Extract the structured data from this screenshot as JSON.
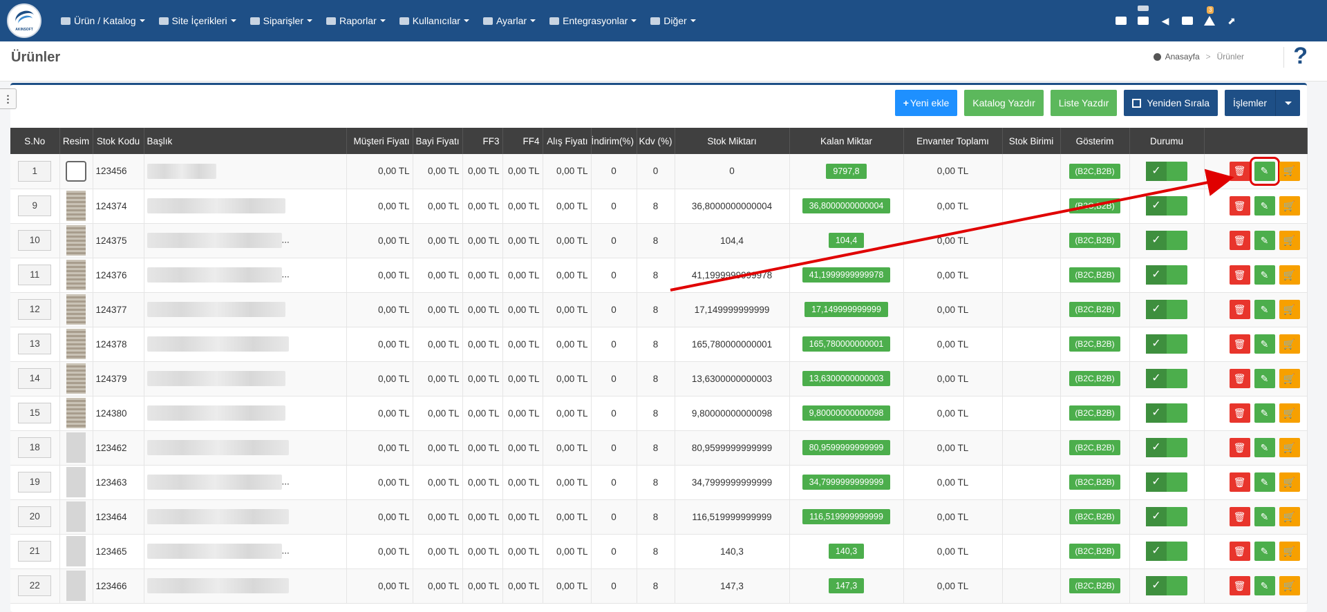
{
  "topbar": {
    "logo_text": "AKINSOFT",
    "nav": [
      {
        "label": "Ürün / Katalog",
        "icon": "boxes-icon"
      },
      {
        "label": "Site İçerikleri",
        "icon": "pages-icon"
      },
      {
        "label": "Siparişler",
        "icon": "truck-icon"
      },
      {
        "label": "Raporlar",
        "icon": "report-icon"
      },
      {
        "label": "Kullanıcılar",
        "icon": "users-icon"
      },
      {
        "label": "Ayarlar",
        "icon": "gears-icon"
      },
      {
        "label": "Entegrasyonlar",
        "icon": "sitemap-icon"
      },
      {
        "label": "Diğer",
        "icon": "copy-icon"
      }
    ],
    "notification_count": "3"
  },
  "header": {
    "title": "Ürünler",
    "breadcrumb_home": "Anasayfa",
    "breadcrumb_sep": ">",
    "breadcrumb_current": "Ürünler",
    "help": "?"
  },
  "toolbar": {
    "new_label": "Yeni ekle",
    "catalog_print": "Katalog Yazdır",
    "list_print": "Liste Yazdır",
    "reorder": "Yeniden Sırala",
    "actions": "İşlemler"
  },
  "table": {
    "headers": [
      "S.No",
      "Resim",
      "Stok Kodu",
      "Başlık",
      "Müşteri Fiyatı",
      "Bayi Fiyatı",
      "FF3",
      "FF4",
      "Alış Fiyatı",
      "İndirim(%)",
      "Kdv (%)",
      "Stok Miktarı",
      "Kalan Miktar",
      "Envanter Toplamı",
      "Stok Birimi",
      "Gösterim",
      "Durumu",
      ""
    ],
    "rows": [
      {
        "sno": "1",
        "img": "camera",
        "code": "123456",
        "title_w": 100,
        "more": "",
        "musteri": "0,00 TL",
        "bayi": "0,00 TL",
        "ff3": "0,00 TL",
        "ff4": "0,00 TL",
        "alis": "0,00 TL",
        "indirim": "0",
        "kdv": "0",
        "stok": "0",
        "kalan": "9797,8",
        "envanter": "0,00 TL",
        "gosterim": "(B2C,B2B)"
      },
      {
        "sno": "9",
        "img": "paper",
        "code": "124374",
        "title_w": 200,
        "more": "",
        "musteri": "0,00 TL",
        "bayi": "0,00 TL",
        "ff3": "0,00 TL",
        "ff4": "0,00 TL",
        "alis": "0,00 TL",
        "indirim": "0",
        "kdv": "8",
        "stok": "36,8000000000004",
        "kalan": "36,8000000000004",
        "envanter": "0,00 TL",
        "gosterim": "(B2C,B2B)"
      },
      {
        "sno": "10",
        "img": "paper",
        "code": "124375",
        "title_w": 195,
        "more": "...",
        "musteri": "0,00 TL",
        "bayi": "0,00 TL",
        "ff3": "0,00 TL",
        "ff4": "0,00 TL",
        "alis": "0,00 TL",
        "indirim": "0",
        "kdv": "8",
        "stok": "104,4",
        "kalan": "104,4",
        "envanter": "0,00 TL",
        "gosterim": "(B2C,B2B)"
      },
      {
        "sno": "11",
        "img": "paper",
        "code": "124376",
        "title_w": 195,
        "more": "...",
        "musteri": "0,00 TL",
        "bayi": "0,00 TL",
        "ff3": "0,00 TL",
        "ff4": "0,00 TL",
        "alis": "0,00 TL",
        "indirim": "0",
        "kdv": "8",
        "stok": "41,1999999999978",
        "kalan": "41,1999999999978",
        "envanter": "0,00 TL",
        "gosterim": "(B2C,B2B)"
      },
      {
        "sno": "12",
        "img": "paper",
        "code": "124377",
        "title_w": 200,
        "more": "",
        "musteri": "0,00 TL",
        "bayi": "0,00 TL",
        "ff3": "0,00 TL",
        "ff4": "0,00 TL",
        "alis": "0,00 TL",
        "indirim": "0",
        "kdv": "8",
        "stok": "17,149999999999",
        "kalan": "17,149999999999",
        "envanter": "0,00 TL",
        "gosterim": "(B2C,B2B)"
      },
      {
        "sno": "13",
        "img": "paper",
        "code": "124378",
        "title_w": 205,
        "more": "",
        "musteri": "0,00 TL",
        "bayi": "0,00 TL",
        "ff3": "0,00 TL",
        "ff4": "0,00 TL",
        "alis": "0,00 TL",
        "indirim": "0",
        "kdv": "8",
        "stok": "165,780000000001",
        "kalan": "165,780000000001",
        "envanter": "0,00 TL",
        "gosterim": "(B2C,B2B)"
      },
      {
        "sno": "14",
        "img": "paper",
        "code": "124379",
        "title_w": 200,
        "more": "",
        "musteri": "0,00 TL",
        "bayi": "0,00 TL",
        "ff3": "0,00 TL",
        "ff4": "0,00 TL",
        "alis": "0,00 TL",
        "indirim": "0",
        "kdv": "8",
        "stok": "13,6300000000003",
        "kalan": "13,6300000000003",
        "envanter": "0,00 TL",
        "gosterim": "(B2C,B2B)"
      },
      {
        "sno": "15",
        "img": "paper",
        "code": "124380",
        "title_w": 200,
        "more": "",
        "musteri": "0,00 TL",
        "bayi": "0,00 TL",
        "ff3": "0,00 TL",
        "ff4": "0,00 TL",
        "alis": "0,00 TL",
        "indirim": "0",
        "kdv": "8",
        "stok": "9,80000000000098",
        "kalan": "9,80000000000098",
        "envanter": "0,00 TL",
        "gosterim": "(B2C,B2B)"
      },
      {
        "sno": "18",
        "img": "plain",
        "code": "123462",
        "title_w": 205,
        "more": "",
        "musteri": "0,00 TL",
        "bayi": "0,00 TL",
        "ff3": "0,00 TL",
        "ff4": "0,00 TL",
        "alis": "0,00 TL",
        "indirim": "0",
        "kdv": "8",
        "stok": "80,9599999999999",
        "kalan": "80,9599999999999",
        "envanter": "0,00 TL",
        "gosterim": "(B2C,B2B)"
      },
      {
        "sno": "19",
        "img": "plain",
        "code": "123463",
        "title_w": 195,
        "more": "...",
        "musteri": "0,00 TL",
        "bayi": "0,00 TL",
        "ff3": "0,00 TL",
        "ff4": "0,00 TL",
        "alis": "0,00 TL",
        "indirim": "0",
        "kdv": "8",
        "stok": "34,7999999999999",
        "kalan": "34,7999999999999",
        "envanter": "0,00 TL",
        "gosterim": "(B2C,B2B)"
      },
      {
        "sno": "20",
        "img": "plain",
        "code": "123464",
        "title_w": 205,
        "more": "",
        "musteri": "0,00 TL",
        "bayi": "0,00 TL",
        "ff3": "0,00 TL",
        "ff4": "0,00 TL",
        "alis": "0,00 TL",
        "indirim": "0",
        "kdv": "8",
        "stok": "116,519999999999",
        "kalan": "116,519999999999",
        "envanter": "0,00 TL",
        "gosterim": "(B2C,B2B)"
      },
      {
        "sno": "21",
        "img": "plain",
        "code": "123465",
        "title_w": 195,
        "more": "...",
        "musteri": "0,00 TL",
        "bayi": "0,00 TL",
        "ff3": "0,00 TL",
        "ff4": "0,00 TL",
        "alis": "0,00 TL",
        "indirim": "0",
        "kdv": "8",
        "stok": "140,3",
        "kalan": "140,3",
        "envanter": "0,00 TL",
        "gosterim": "(B2C,B2B)"
      },
      {
        "sno": "22",
        "img": "plain",
        "code": "123466",
        "title_w": 205,
        "more": "",
        "musteri": "0,00 TL",
        "bayi": "0,00 TL",
        "ff3": "0,00 TL",
        "ff4": "0,00 TL",
        "alis": "0,00 TL",
        "indirim": "0",
        "kdv": "8",
        "stok": "147,3",
        "kalan": "147,3",
        "envanter": "0,00 TL",
        "gosterim": "(B2C,B2B)"
      }
    ]
  },
  "colors": {
    "nav_bg": "#1e4f86",
    "green": "#4cae4c",
    "red": "#e8352c",
    "orange": "#f7a000",
    "annotation": "#e00000"
  }
}
